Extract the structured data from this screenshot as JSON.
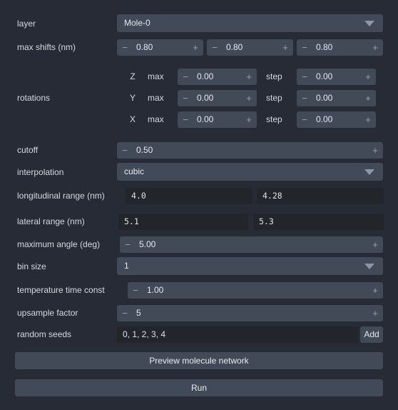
{
  "form": {
    "layer": {
      "label": "layer",
      "value": "Mole-0"
    },
    "max_shifts": {
      "label": "max shifts (nm)",
      "values": [
        "0.80",
        "0.80",
        "0.80"
      ],
      "minus": "−",
      "plus": "+"
    },
    "rotations": {
      "label": "rotations",
      "max_caption": "max",
      "step_caption": "step",
      "axes": [
        {
          "axis": "Z",
          "max": "0.00",
          "step": "0.00"
        },
        {
          "axis": "Y",
          "max": "0.00",
          "step": "0.00"
        },
        {
          "axis": "X",
          "max": "0.00",
          "step": "0.00"
        }
      ]
    },
    "cutoff": {
      "label": "cutoff",
      "value": "0.50"
    },
    "interpolation": {
      "label": "interpolation",
      "value": "cubic"
    },
    "longitudinal_range": {
      "label": "longitudinal range (nm)",
      "min": "4.0",
      "max": "4.28"
    },
    "lateral_range": {
      "label": "lateral range (nm)",
      "min": "5.1",
      "max": "5.3"
    },
    "maximum_angle": {
      "label": "maximum angle (deg)",
      "value": "5.00"
    },
    "bin_size": {
      "label": "bin size",
      "value": "1"
    },
    "temperature_time_const": {
      "label": "temperature time const",
      "value": "1.00"
    },
    "upsample_factor": {
      "label": "upsample factor",
      "value": "5"
    },
    "random_seeds": {
      "label": "random seeds",
      "value": "0, 1, 2, 3, 4",
      "add_label": "Add"
    }
  },
  "actions": {
    "preview": "Preview molecule network",
    "run": "Run"
  },
  "glyphs": {
    "minus": "−",
    "plus": "+"
  },
  "colors": {
    "background": "#272b35",
    "widget": "#434a57",
    "field": "#222529",
    "text": "#d7dbe0",
    "muted": "#9aa2b0"
  }
}
